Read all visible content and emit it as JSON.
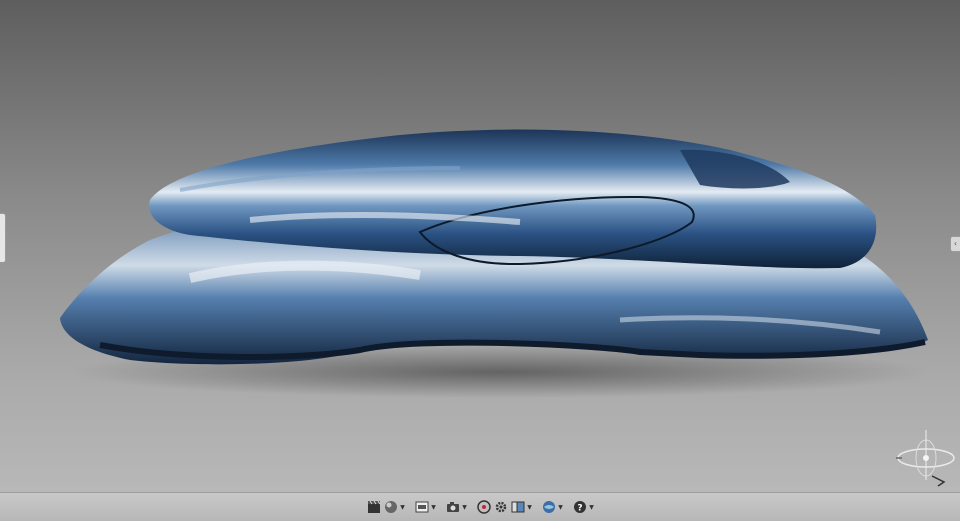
{
  "viewport": {
    "background_top": "#5e5e5e",
    "background_bottom": "#b8b8b8",
    "model_color": "#2f5a8c",
    "model_highlight": "#dfe6ee"
  },
  "right_tab": {
    "glyph": "‹"
  },
  "toolbar": {
    "buttons": [
      {
        "name": "clapperboard-icon"
      },
      {
        "name": "render-sphere-icon"
      },
      {
        "name": "display-mode-icon"
      },
      {
        "name": "camera-icon"
      },
      {
        "name": "orbit-icon"
      },
      {
        "name": "settings-gear-icon"
      },
      {
        "name": "view-layout-icon"
      },
      {
        "name": "environment-icon"
      },
      {
        "name": "help-icon"
      }
    ],
    "help_glyph": "?"
  }
}
